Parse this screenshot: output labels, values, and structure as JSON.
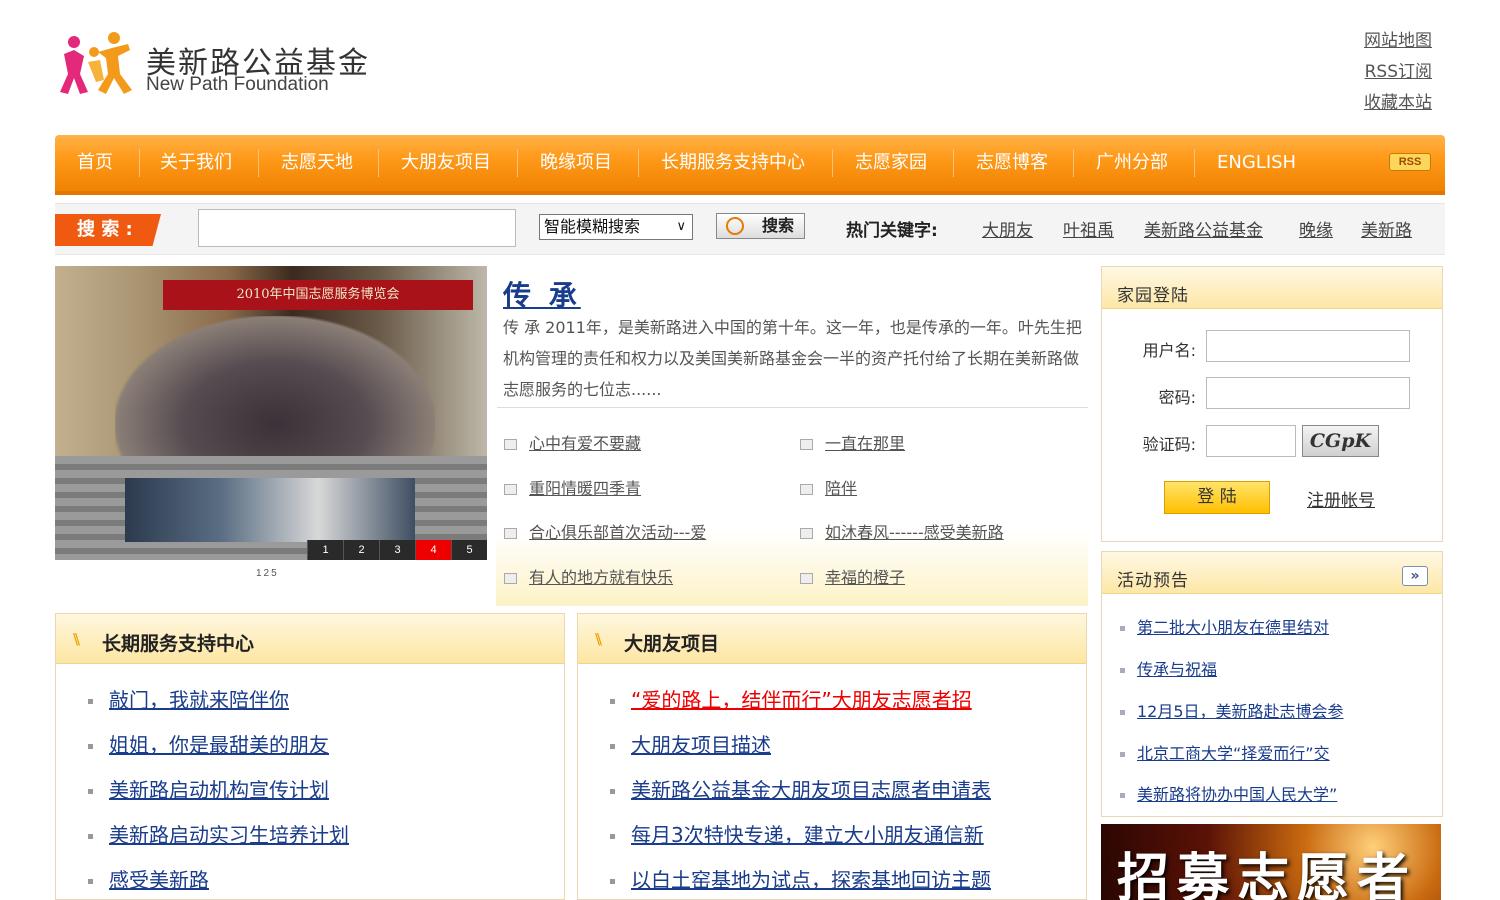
{
  "header": {
    "logo_cn": "美新路公益基金",
    "logo_en": "New Path Foundation",
    "top_links": [
      "网站地图",
      "RSS订阅",
      "收藏本站"
    ]
  },
  "nav": {
    "items": [
      "首页",
      "关于我们",
      "志愿天地",
      "大朋友项目",
      "晚缘项目",
      "长期服务支持中心",
      "志愿家园",
      "志愿博客",
      "广州分部",
      "ENGLISH"
    ],
    "rss": "RSS"
  },
  "search": {
    "label": "搜 索 :",
    "input_value": "",
    "select_value": "智能模糊搜索",
    "button": "搜索",
    "hot_label": "热门关键字:",
    "hot_keywords": [
      "大朋友",
      "叶祖禹",
      "美新路公益基金",
      "晚缘",
      "美新路"
    ]
  },
  "banner": {
    "sign": "2010年中国志愿服务博览会",
    "pager": [
      "1",
      "2",
      "3",
      "4",
      "5"
    ],
    "active_page": "4",
    "caption": "125"
  },
  "feature": {
    "title": "传 承",
    "desc": "传 承 2011年，是美新路进入中国的第十年。这一年，也是传承的一年。叶先生把机构管理的责任和权力以及美国美新路基金会一半的资产托付给了长期在美新路做志愿服务的七位志......",
    "items": [
      "心中有爱不要藏",
      "一直在那里",
      "重阳情暖四季青",
      "陪伴",
      "合心俱乐部首次活动---爱",
      "如沐春风------感受美新路",
      "有人的地方就有快乐",
      "幸福的橙子"
    ]
  },
  "login": {
    "title": "家园登陆",
    "username_label": "用户名:",
    "password_label": "密码:",
    "captcha_label": "验证码:",
    "captcha_text": "CGpK",
    "login_button": "登 陆",
    "register_link": "注册帐号"
  },
  "events": {
    "title": "活动预告",
    "more": "»",
    "items": [
      "第二批大小朋友在德里结对",
      "传承与祝福",
      "12月5日，美新路赴志博会参",
      "北京工商大学“择爱而行”交",
      "美新路将协办中国人民大学”"
    ]
  },
  "recruit": {
    "text": "招募志愿者"
  },
  "panels": [
    {
      "title": "长期服务支持中心",
      "items": [
        "敲门，我就来陪伴你",
        "姐姐，你是最甜美的朋友",
        "美新路启动机构宣传计划",
        "美新路启动实习生培养计划",
        "感受美新路"
      ]
    },
    {
      "title": "大朋友项目",
      "items": [
        "“爱的路上，结伴而行”大朋友志愿者招",
        "大朋友项目描述",
        "美新路公益基金大朋友项目志愿者申请表",
        "每月3次特快专递，建立大小朋友通信新",
        "以白土窑基地为试点，探索基地回访主题"
      ]
    }
  ],
  "colors": {
    "nav_orange": "#ff9a1a",
    "link_blue": "#1a3c8c",
    "search_label_red": "#f05a10",
    "highlight_red": "#e00000"
  }
}
